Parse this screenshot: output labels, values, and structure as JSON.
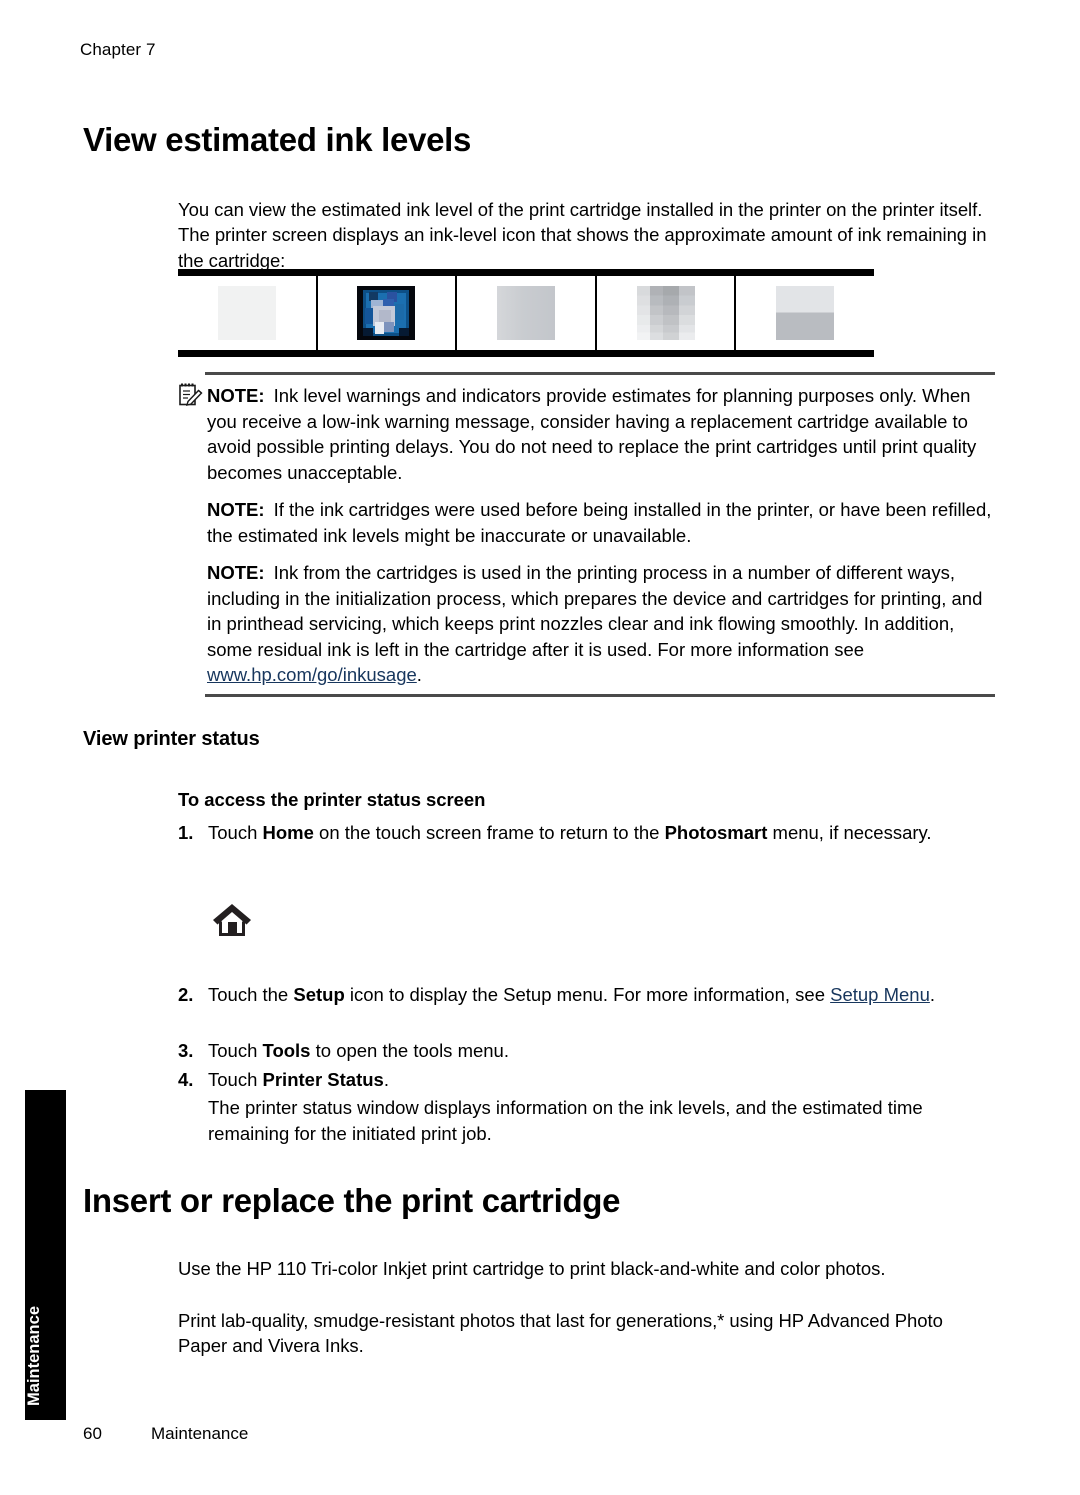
{
  "page": {
    "chapter_label": "Chapter 7",
    "footer_page_number": "60",
    "footer_section": "Maintenance",
    "side_tab_label": "Maintenance",
    "link_color": "#17365d"
  },
  "sections": {
    "ink_levels": {
      "title": "View estimated ink levels",
      "intro": "You can view the estimated ink level of the print cartridge installed in the printer on the printer itself. The printer screen displays an ink-level icon that shows the approximate amount of ink remaining in the cartridge:",
      "swatches": [
        {
          "name": "ink-swatch-empty",
          "style": "empty"
        },
        {
          "name": "ink-swatch-droplet",
          "style": "ink-drop"
        },
        {
          "name": "ink-swatch-full-gray",
          "style": "gray"
        },
        {
          "name": "ink-swatch-gradient",
          "style": "pixgray"
        },
        {
          "name": "ink-swatch-half",
          "style": "half"
        }
      ],
      "notes": [
        {
          "icon": "note-pad-pencil-icon",
          "lead": "NOTE:",
          "text": "Ink level warnings and indicators provide estimates for planning purposes only. When you receive a low-ink warning message, consider having a replacement cartridge available to avoid possible printing delays. You do not need to replace the print cartridges until print quality becomes unacceptable."
        },
        {
          "icon": null,
          "lead": "NOTE:",
          "text": "If the ink cartridges were used before being installed in the printer, or have been refilled, the estimated ink levels might be inaccurate or unavailable."
        },
        {
          "icon": null,
          "lead": "NOTE:",
          "text_before_link": "Ink from the cartridges is used in the printing process in a number of different ways, including in the initialization process, which prepares the device and cartridges for printing, and in printhead servicing, which keeps print nozzles clear and ink flowing smoothly. In addition, some residual ink is left in the cartridge after it is used. For more information see ",
          "link_text": "www.hp.com/go/inkusage",
          "text_after_link": "."
        }
      ]
    },
    "printer_status": {
      "title": "View printer status",
      "procedure_title": "To access the printer status screen",
      "steps": [
        {
          "number": "1.",
          "parts": [
            {
              "t": "Touch ",
              "b": false
            },
            {
              "t": "Home",
              "b": true
            },
            {
              "t": " on the touch screen frame to return to the ",
              "b": false
            },
            {
              "t": "Photosmart",
              "b": true
            },
            {
              "t": " menu, if necessary.",
              "b": false
            }
          ]
        },
        {
          "number": "2.",
          "parts": [
            {
              "t": "Touch the ",
              "b": false
            },
            {
              "t": "Setup",
              "b": true
            },
            {
              "t": " icon to display the Setup menu. For more information, see ",
              "b": false
            },
            {
              "t": "Setup Menu",
              "b": false,
              "link": true
            },
            {
              "t": ".",
              "b": false
            }
          ]
        },
        {
          "number": "3.",
          "parts": [
            {
              "t": "Touch ",
              "b": false
            },
            {
              "t": "Tools",
              "b": true
            },
            {
              "t": " to open the tools menu.",
              "b": false
            }
          ]
        },
        {
          "number": "4.",
          "parts": [
            {
              "t": "Touch ",
              "b": false
            },
            {
              "t": "Printer Status",
              "b": true
            },
            {
              "t": ".",
              "b": false
            }
          ]
        }
      ],
      "home_icon_name": "home-icon",
      "closing_text": "The printer status window displays information on the ink levels, and the estimated time remaining for the initiated print job."
    },
    "insert_cartridge": {
      "title": "Insert or replace the print cartridge",
      "paragraph_1": "Use the HP 110 Tri-color Inkjet print cartridge to print black-and-white and color photos.",
      "paragraph_2": "Print lab-quality, smudge-resistant photos that last for generations,* using HP Advanced Photo Paper and Vivera Inks."
    }
  }
}
